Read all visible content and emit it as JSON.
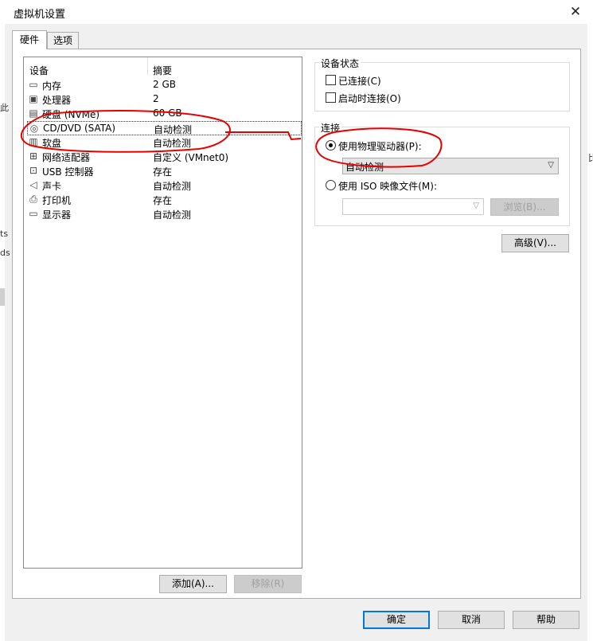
{
  "window": {
    "title": "虚拟机设置",
    "close_glyph": "✕"
  },
  "tabs": [
    {
      "label": "硬件"
    },
    {
      "label": "选项"
    }
  ],
  "device_list": {
    "header_device": "设备",
    "header_summary": "摘要",
    "rows": [
      {
        "name": "内存",
        "summary": "2 GB",
        "icon": "memory-icon"
      },
      {
        "name": "处理器",
        "summary": "2",
        "icon": "cpu-icon"
      },
      {
        "name": "硬盘 (NVMe)",
        "summary": "60 GB",
        "icon": "hard-disk-icon"
      },
      {
        "name": "CD/DVD (SATA)",
        "summary": "自动检测",
        "icon": "cd-dvd-icon",
        "selected": true
      },
      {
        "name": "软盘",
        "summary": "自动检测",
        "icon": "floppy-icon"
      },
      {
        "name": "网络适配器",
        "summary": "自定义 (VMnet0)",
        "icon": "network-adapter-icon"
      },
      {
        "name": "USB 控制器",
        "summary": "存在",
        "icon": "usb-icon"
      },
      {
        "name": "声卡",
        "summary": "自动检测",
        "icon": "sound-card-icon"
      },
      {
        "name": "打印机",
        "summary": "存在",
        "icon": "printer-icon"
      },
      {
        "name": "显示器",
        "summary": "自动检测",
        "icon": "display-icon"
      }
    ]
  },
  "list_buttons": {
    "add": "添加(A)...",
    "remove": "移除(R)"
  },
  "device_status": {
    "label": "设备状态",
    "connected": {
      "label": "已连接(C)",
      "checked": false
    },
    "connect_at_power_on": {
      "label": "启动时连接(O)",
      "checked": false
    }
  },
  "connection": {
    "label": "连接",
    "physical": {
      "label": "使用物理驱动器(P):",
      "selected": true,
      "combo_value": "自动检测"
    },
    "iso": {
      "label": "使用 ISO 映像文件(M):",
      "selected": false,
      "combo_value": "",
      "browse_label": "浏览(B)..."
    }
  },
  "advanced_label": "高级(V)...",
  "footer": {
    "ok": "确定",
    "cancel": "取消",
    "help": "帮助"
  },
  "background_fragments": {
    "e1": "此",
    "e2": "ts",
    "e3": "ds",
    "e4": "比"
  },
  "colors": {
    "annotation_red": "#e60000",
    "focus_blue": "#0078d7"
  }
}
